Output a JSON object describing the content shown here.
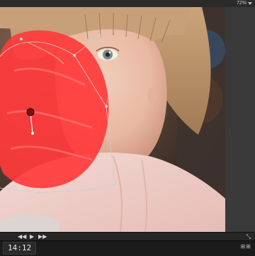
{
  "viewer": {
    "zoom_label": "72%",
    "zoom_icon": "chevron-down-icon"
  },
  "scene": {
    "subject": "girl-photo",
    "mask_color": "#ff3b3b",
    "bezier_color": "#cfcfcf",
    "control_point_color": "#7a1010"
  },
  "transport": {
    "prev_label": "◀◀",
    "play_label": "▶",
    "next_label": "▶▶",
    "fullscreen_label": "⤡"
  },
  "status": {
    "timecode": "14:12",
    "right_indicator": "⊞⊞"
  }
}
